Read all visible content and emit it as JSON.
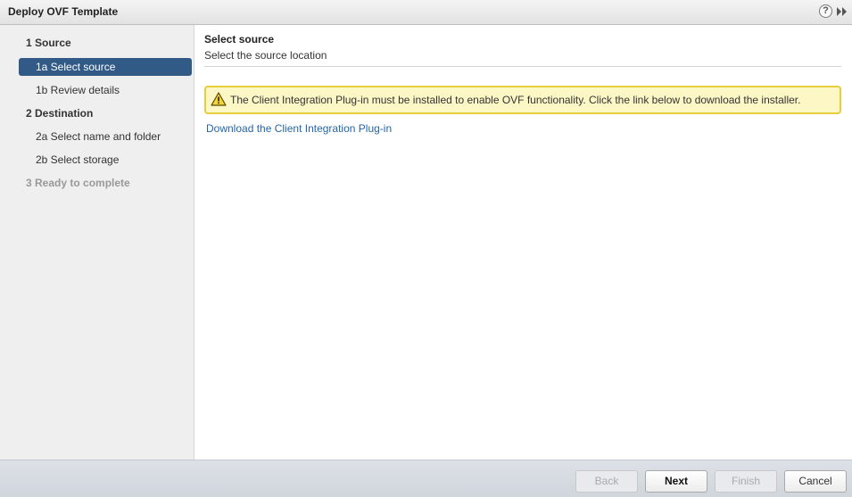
{
  "window": {
    "title": "Deploy OVF Template",
    "help_glyph": "?"
  },
  "steps": [
    {
      "label": "1  Source",
      "level": "main",
      "state": "done"
    },
    {
      "label": "1a  Select source",
      "level": "sub",
      "state": "active"
    },
    {
      "label": "1b  Review details",
      "level": "sub",
      "state": "normal"
    },
    {
      "label": "2  Destination",
      "level": "main",
      "state": "normal"
    },
    {
      "label": "2a  Select name and folder",
      "level": "sub",
      "state": "normal"
    },
    {
      "label": "2b  Select storage",
      "level": "sub",
      "state": "normal"
    },
    {
      "label": "3  Ready to complete",
      "level": "main",
      "state": "disabled"
    }
  ],
  "content": {
    "title": "Select source",
    "subtitle": "Select the source location",
    "warning": "The Client Integration Plug-in must be installed to enable OVF functionality. Click the link below to download the installer.",
    "link": "Download the Client Integration Plug-in"
  },
  "footer": {
    "back": "Back",
    "next": "Next",
    "finish": "Finish",
    "cancel": "Cancel"
  },
  "colors": {
    "active_step": "#315a86",
    "warning_bg": "#fdf7c6",
    "warning_border": "#e8cd3c",
    "link": "#2466a8"
  }
}
